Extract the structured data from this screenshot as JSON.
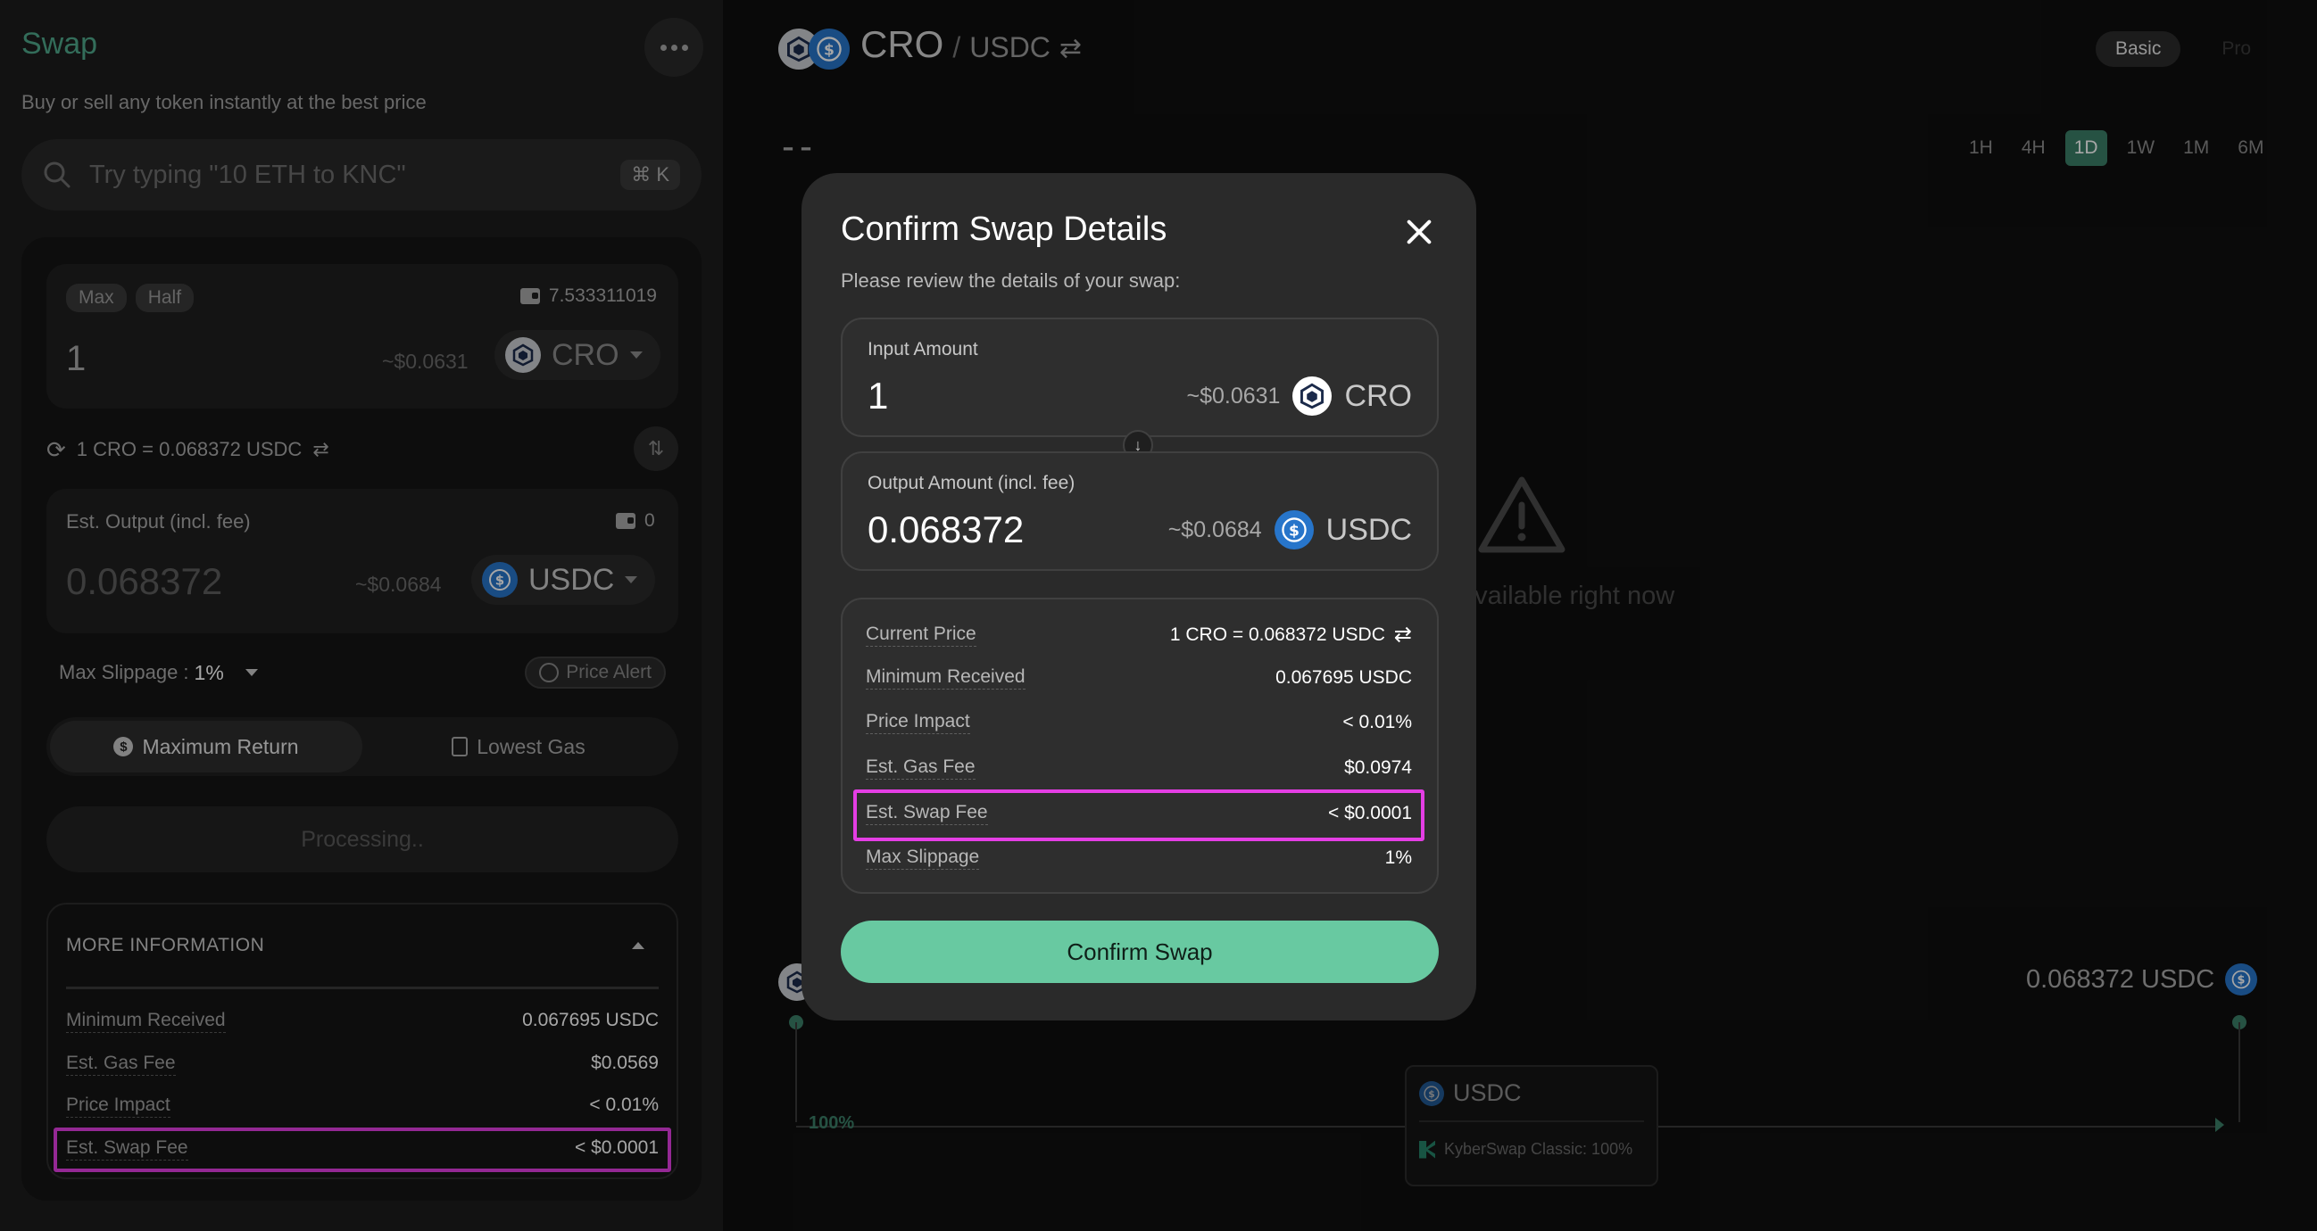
{
  "swap": {
    "title": "Swap",
    "subtitle": "Buy or sell any token instantly at the best price",
    "search": {
      "placeholder": "Try typing \"10 ETH to KNC\"",
      "shortcut": "⌘ K"
    },
    "input": {
      "max": "Max",
      "half": "Half",
      "balance": "7.533311019",
      "amount": "1",
      "usd": "~$0.0631",
      "token": "CRO"
    },
    "rate": "1 CRO = 0.068372 USDC",
    "output": {
      "label": "Est. Output (incl. fee)",
      "balance": "0",
      "amount": "0.068372",
      "usd": "~$0.0684",
      "token": "USDC"
    },
    "slippage": {
      "label": "Max Slippage :",
      "value": "1%"
    },
    "price_alert": "Price Alert",
    "route_tabs": [
      {
        "label": "Maximum Return",
        "active": true
      },
      {
        "label": "Lowest Gas",
        "active": false
      }
    ],
    "processing": "Processing..",
    "more_info": {
      "title": "MORE INFORMATION",
      "rows": [
        {
          "label": "Minimum Received",
          "value": "0.067695 USDC"
        },
        {
          "label": "Est. Gas Fee",
          "value": "$0.0569"
        },
        {
          "label": "Price Impact",
          "value": "< 0.01%"
        },
        {
          "label": "Est. Swap Fee",
          "value": "< $0.0001"
        }
      ]
    }
  },
  "chart_panel": {
    "pair_base": "CRO",
    "pair_sep": "/",
    "pair_quote": "USDC",
    "modes": [
      "Basic",
      "Pro"
    ],
    "price": "--",
    "timeframes": [
      "1H",
      "4H",
      "1D",
      "1W",
      "1M",
      "6M"
    ],
    "active_timeframe": "1D",
    "unavailable": "available right now",
    "route": {
      "output": "0.068372 USDC",
      "percent": "100%",
      "token": "USDC",
      "dex": "KyberSwap Classic: 100%"
    }
  },
  "modal": {
    "title": "Confirm Swap Details",
    "subtitle": "Please review the details of your swap:",
    "input": {
      "label": "Input Amount",
      "amount": "1",
      "usd": "~$0.0631",
      "token": "CRO"
    },
    "output": {
      "label": "Output Amount (incl. fee)",
      "amount": "0.068372",
      "usd": "~$0.0684",
      "token": "USDC"
    },
    "details": [
      {
        "label": "Current Price",
        "value": "1 CRO = 0.068372 USDC"
      },
      {
        "label": "Minimum Received",
        "value": "0.067695 USDC"
      },
      {
        "label": "Price Impact",
        "value": "< 0.01%"
      },
      {
        "label": "Est. Gas Fee",
        "value": "$0.0974"
      },
      {
        "label": "Est. Swap Fee",
        "value": "< $0.0001"
      },
      {
        "label": "Max Slippage",
        "value": "1%"
      }
    ],
    "confirm": "Confirm Swap"
  },
  "colors": {
    "accent": "#68c9a1",
    "brand_green": "#4fa88a",
    "highlight": "#e43ee4",
    "usdc": "#2775ca"
  },
  "icons": [
    "more-icon",
    "search-icon",
    "wallet-icon",
    "cro-coin-icon",
    "usdc-coin-icon",
    "refresh-icon",
    "swap-direction-icon",
    "clock-icon",
    "dollar-icon",
    "gas-pump-icon",
    "warning-icon",
    "close-icon",
    "arrow-down-icon",
    "kyberswap-icon"
  ]
}
